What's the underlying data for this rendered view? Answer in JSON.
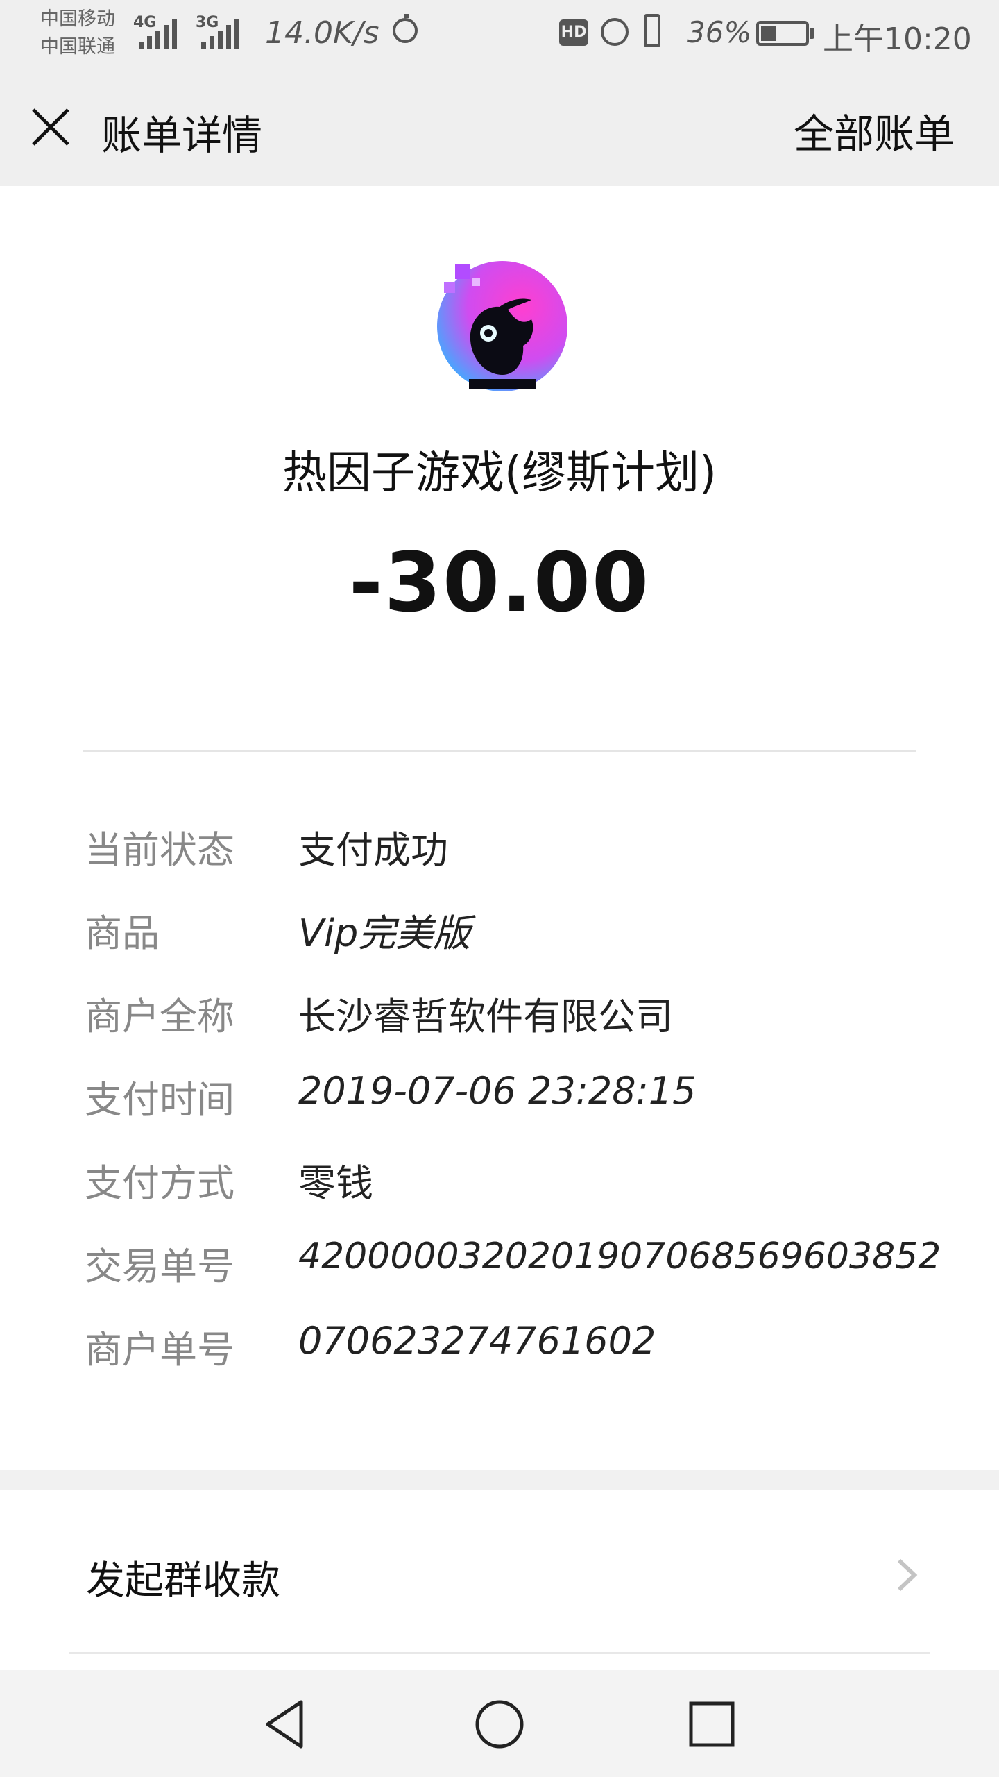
{
  "status_bar": {
    "carrier_1": "中国移动",
    "carrier_2": "中国联通",
    "net_type_1": "4G",
    "net_type_2": "3G",
    "net_speed": "14.0K/s",
    "hd_badge": "HD",
    "battery_percent": "36%",
    "battery_level": 0.36,
    "time": "上午10:20"
  },
  "header": {
    "title": "账单详情",
    "all_bills_link": "全部账单"
  },
  "transaction": {
    "merchant_name": "热因子游戏(缪斯计划)",
    "amount": "-30.00"
  },
  "details": [
    {
      "label": "当前状态",
      "value": "支付成功"
    },
    {
      "label": "商品",
      "value": "Vip完美版"
    },
    {
      "label": "商户全称",
      "value": "长沙睿哲软件有限公司"
    },
    {
      "label": "支付时间",
      "value": "2019-07-06 23:28:15"
    },
    {
      "label": "支付方式",
      "value": "零钱"
    },
    {
      "label": "交易单号",
      "value": "4200000320201907068569603852"
    },
    {
      "label": "商户单号",
      "value": "070623274761602"
    }
  ],
  "actions": {
    "group_collect": "发起群收款"
  },
  "icons": {
    "close": "close-icon",
    "chevron": "chevron-right-icon",
    "back": "back-triangle-icon",
    "home": "home-circle-icon",
    "recents": "recents-square-icon"
  },
  "colors": {
    "header_bg": "#efefef",
    "label_gray": "#888888",
    "text_dark": "#111111"
  }
}
